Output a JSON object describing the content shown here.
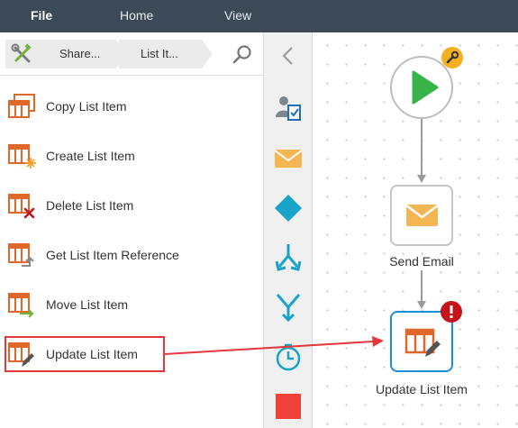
{
  "menu": {
    "file": "File",
    "home": "Home",
    "view": "View"
  },
  "breadcrumb": {
    "items": [
      "Share...",
      "List It..."
    ]
  },
  "actions": [
    {
      "label": "Copy List Item",
      "icon": "copy-list-item-icon"
    },
    {
      "label": "Create List Item",
      "icon": "create-list-item-icon"
    },
    {
      "label": "Delete List Item",
      "icon": "delete-list-item-icon"
    },
    {
      "label": "Get List Item Reference",
      "icon": "get-list-item-reference-icon"
    },
    {
      "label": "Move List Item",
      "icon": "move-list-item-icon"
    },
    {
      "label": "Update List Item",
      "icon": "update-list-item-icon"
    }
  ],
  "toolbox": [
    "assign-task-icon",
    "email-icon",
    "decision-diamond-icon",
    "branch-split-icon",
    "branch-merge-icon",
    "timer-icon",
    "stop-icon"
  ],
  "workflow": {
    "nodes": [
      {
        "name": "start",
        "label": ""
      },
      {
        "name": "send-email",
        "label": "Send Email"
      },
      {
        "name": "update-list-item",
        "label": "Update List Item"
      }
    ]
  },
  "colors": {
    "menubar": "#3b4a56",
    "list_icon": "#e0672a",
    "start_green": "#37b34a",
    "email_yellow": "#f4b553",
    "toolbox_blue": "#1aa3c8",
    "stop_red": "#f0413a",
    "selected_blue": "#1a8fd6",
    "error_red": "#c4151c",
    "annotation_red": "#e5383b"
  }
}
